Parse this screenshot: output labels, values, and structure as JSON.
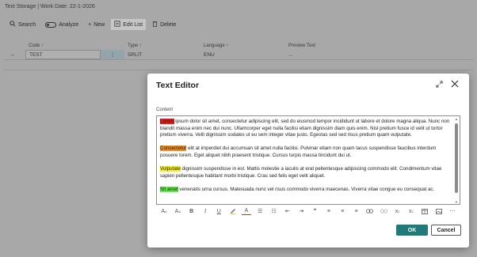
{
  "page": {
    "title": "Text Storage | Work Date: 22-1-2026"
  },
  "toolbar": {
    "search_label": "Search",
    "analyze_label": "Analyze",
    "new_label": "New",
    "edit_list_label": "Edit List",
    "delete_label": "Delete"
  },
  "grid": {
    "columns": [
      "Code ↑",
      "Type ↑",
      "Language ↑",
      "Preview Text"
    ],
    "rows": [
      {
        "code": "TEST",
        "type": "SPLIT",
        "language": "ENU",
        "preview": "..."
      }
    ]
  },
  "dialog": {
    "title": "Text Editor",
    "content_label": "Content",
    "paragraphs": [
      {
        "highlight": "Lorem",
        "highlight_color": "#e41b1b",
        "rest": " ipsum dolor sit amet, consectetur adipiscing elit, sed do eiusmod tempor incididunt ut labore et dolore magna aliqua. Nunc non blandit massa enim nec dui nunc. Ullamcorper eget nulla facilisi etiam dignissim diam quis enim. Nisl pretium fusce id velit ut tortor pretium viverra. Velit dignissim sodales ut eu sem integer vitae justo. Egestas sed sed risus pretium quam vulputate."
      },
      {
        "highlight": "Consectetur",
        "highlight_color": "#f08c1a",
        "rest": " elit at imperdiet dui accumsan sit amet nulla facilisi. Pulvinar etiam non quam lacus suspendisse faucibus interdum posuere lorem. Eget aliquet nibh praesent tristique. Cursus turpis massa tincidunt dui ut."
      },
      {
        "highlight": "Vulputate",
        "highlight_color": "#f7f01a",
        "rest": " dignissim suspendisse in est. Mattis molestie a iaculis at erat pellentesque adipiscing commodo elit. Condimentum vitae sapien pellentesque habitant morbi tristique. Cras sed felis eget velit aliquet."
      },
      {
        "highlight": "Sit amet",
        "highlight_color": "#5ee84a",
        "rest": " venenatis urna cursus. Malesuada nunc vel risus commodo viverra maecenas. Viverra vitae congue eu consequat ac."
      }
    ],
    "ok_label": "OK",
    "cancel_label": "Cancel"
  },
  "format_toolbar": {
    "icons": [
      "font-size-icon",
      "font-size-increase-icon",
      "bold-icon",
      "italic-icon",
      "underline-icon",
      "highlight-pen-icon",
      "font-color-icon",
      "bullet-list-icon",
      "numbered-list-icon",
      "outdent-icon",
      "indent-icon",
      "quote-icon",
      "align-left-icon",
      "align-center-icon",
      "align-right-icon",
      "link-icon",
      "unlink-icon",
      "superscript-icon",
      "subscript-icon",
      "table-icon",
      "image-icon",
      "more-icon"
    ]
  },
  "colors": {
    "accent": "#1f7a78",
    "page_bg": "#a8a8a8",
    "dialog_bg": "#ffffff"
  }
}
